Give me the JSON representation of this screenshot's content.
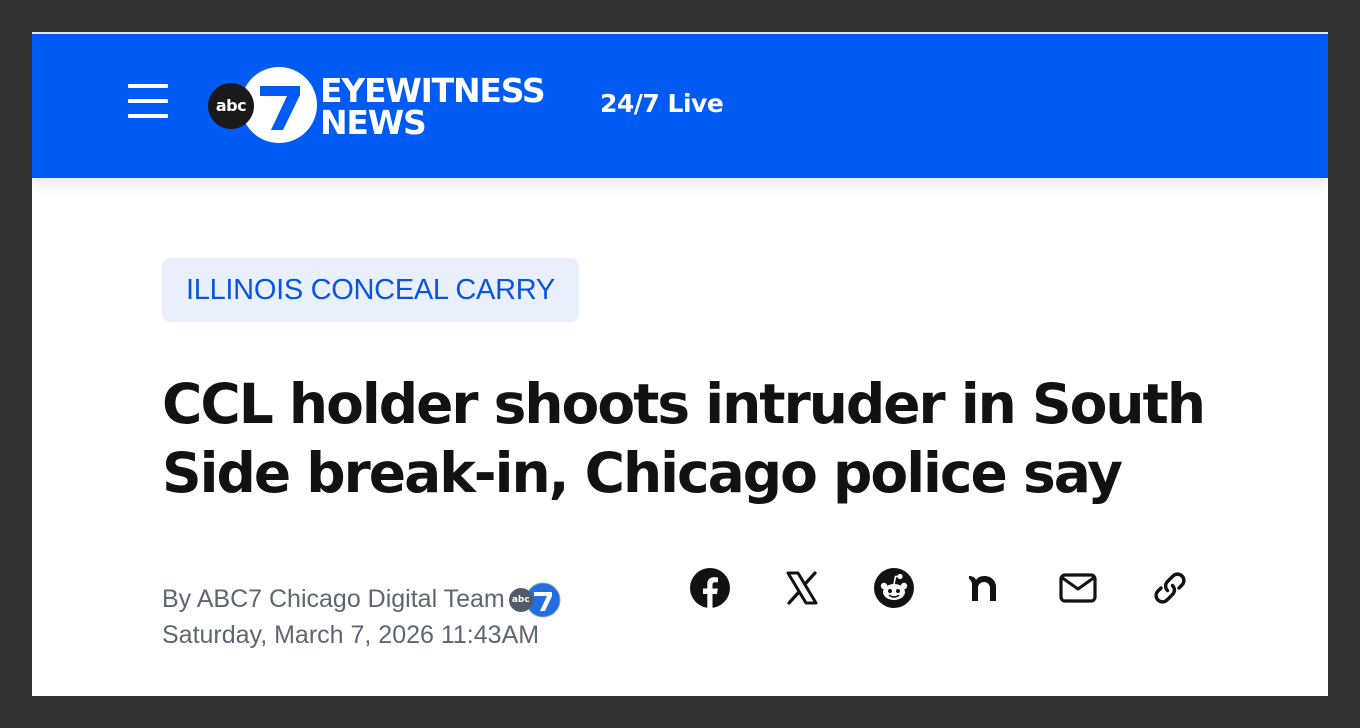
{
  "header": {
    "menu_icon": "hamburger-menu-icon",
    "logo": {
      "abc": "abc",
      "seven": "7",
      "line1": "EYEWITNESS",
      "line2": "NEWS"
    },
    "live_link": "24/7 Live",
    "brand_color": "#005bf5"
  },
  "article": {
    "tag": "ILLINOIS CONCEAL CARRY",
    "headline": "CCL holder shoots intruder in South Side break-in, Chicago police say",
    "byline": "By ABC7 Chicago Digital Team",
    "byline_logo": {
      "abc": "abc",
      "seven": "7"
    },
    "date": "Saturday, March 7, 2026 11:43AM"
  },
  "share": {
    "icons": [
      "facebook-icon",
      "x-icon",
      "reddit-icon",
      "nextdoor-icon",
      "email-icon",
      "link-icon"
    ]
  }
}
